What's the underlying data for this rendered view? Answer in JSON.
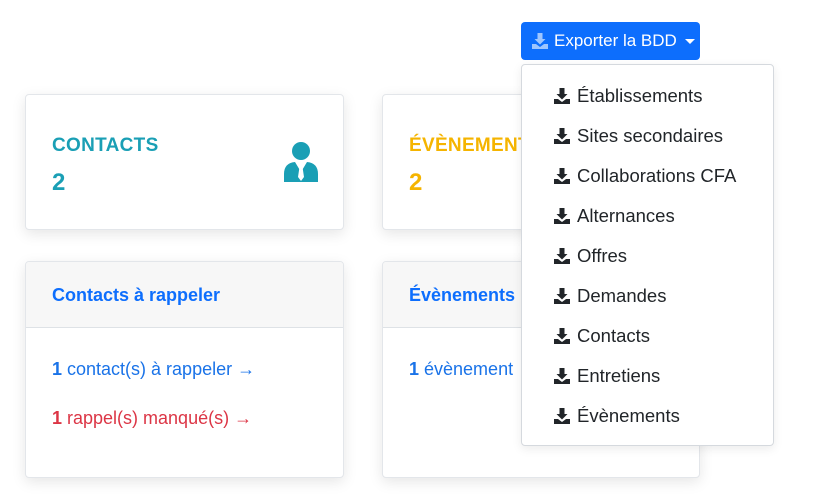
{
  "stats": [
    {
      "label": "CONTACTS",
      "value": "2",
      "icon": "user-tie-icon"
    },
    {
      "label": "ÉVÈNEMENTS",
      "value": "2"
    }
  ],
  "panels": [
    {
      "title": "Contacts à rappeler",
      "lines": [
        {
          "count": "1",
          "text": "contact(s) à rappeler →"
        },
        {
          "count": "1",
          "text": "rappel(s) manqué(s) →"
        }
      ]
    },
    {
      "title": "Évènements",
      "lines": [
        {
          "count": "1",
          "text": "évènement"
        }
      ]
    }
  ],
  "export": {
    "button_label": "Exporter la BDD",
    "icon": "download-icon",
    "items": [
      "Établissements",
      "Sites secondaires",
      "Collaborations CFA",
      "Alternances",
      "Offres",
      "Demandes",
      "Contacts",
      "Entretiens",
      "Évènements"
    ]
  },
  "colors": {
    "primary": "#0d6efd",
    "teal": "#1a9fb5",
    "yellow": "#f5b400",
    "danger": "#dc3545"
  }
}
